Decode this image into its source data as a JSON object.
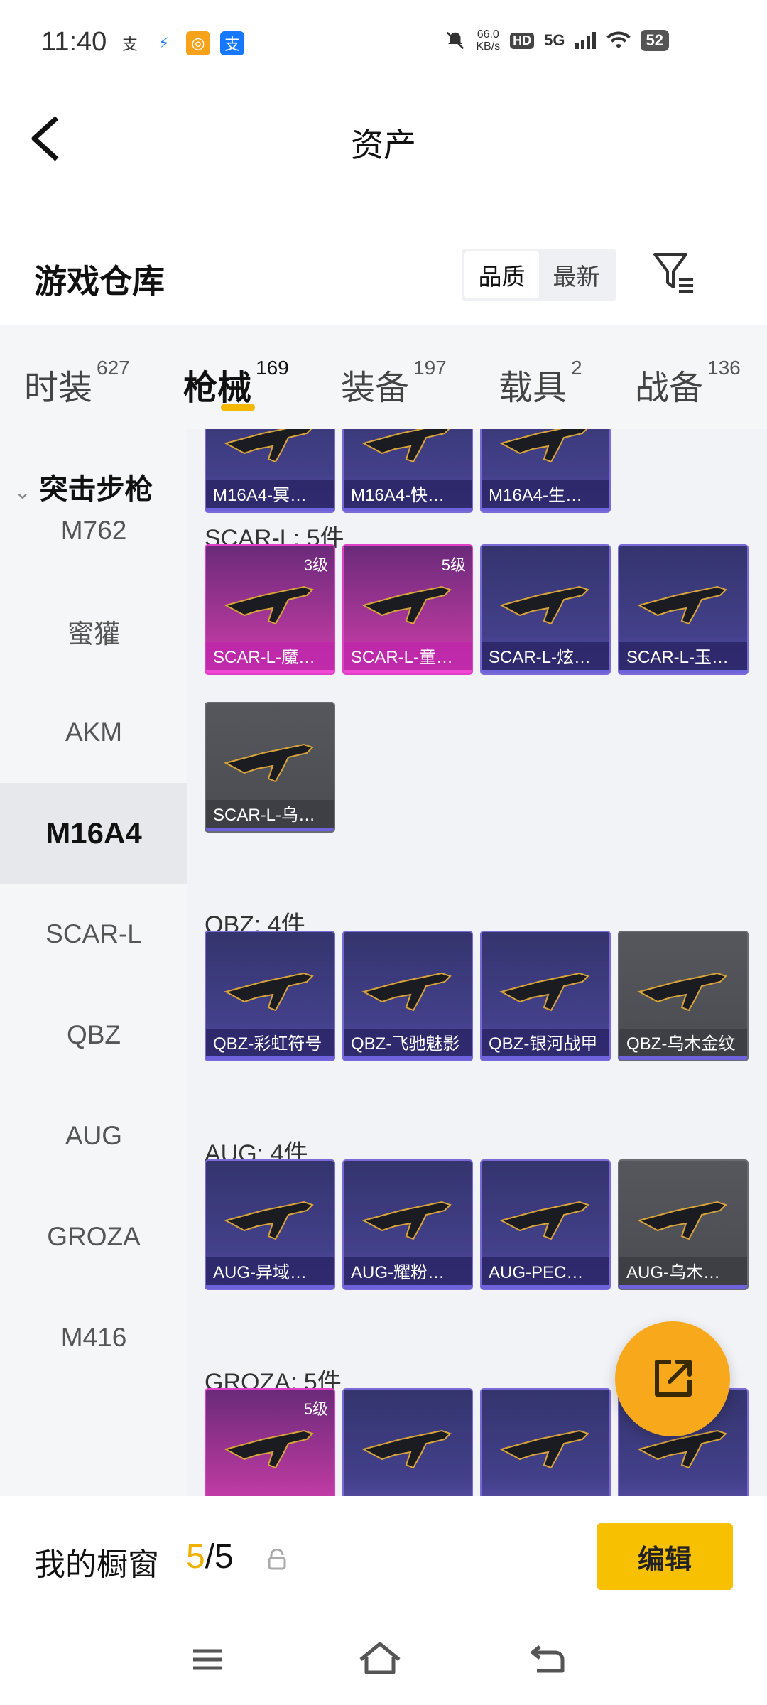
{
  "status_bar": {
    "time": "11:40",
    "apps": [
      {
        "icon": "alipay-outline-icon",
        "label": "支"
      },
      {
        "icon": "bank-app-icon",
        "label": "⚡"
      },
      {
        "icon": "orange-app-icon",
        "label": "◎"
      },
      {
        "icon": "alipay-icon",
        "label": "支"
      }
    ],
    "speed_value": "66.0",
    "speed_unit": "KB/s",
    "hd_label": "HD",
    "network": "5G",
    "battery": "52"
  },
  "header": {
    "title": "资产"
  },
  "warehouse": {
    "title": "游戏仓库",
    "sort_options": [
      "品质",
      "最新"
    ],
    "active_sort": 0
  },
  "tabs": [
    {
      "label": "时装",
      "count": "627"
    },
    {
      "label": "枪械",
      "count": "169"
    },
    {
      "label": "装备",
      "count": "197"
    },
    {
      "label": "载具",
      "count": "2"
    },
    {
      "label": "战备",
      "count": "136"
    }
  ],
  "sidebar": {
    "category": "突击步枪",
    "items": [
      "M762",
      "蜜獾",
      "AKM",
      "M16A4",
      "SCAR-L",
      "QBZ",
      "AUG",
      "GROZA",
      "M416"
    ],
    "selected": "M16A4"
  },
  "content": {
    "m16_partial": [
      {
        "name": "M16A4-冥…",
        "style": "purple"
      },
      {
        "name": "M16A4-快…",
        "style": "purple"
      },
      {
        "name": "M16A4-生…",
        "style": "purple"
      }
    ],
    "sections": [
      {
        "title": "SCAR-L: 5件",
        "items": [
          {
            "name": "SCAR-L-魔…",
            "style": "pink",
            "level": "3级"
          },
          {
            "name": "SCAR-L-童…",
            "style": "pink",
            "level": "5级"
          },
          {
            "name": "SCAR-L-炫…",
            "style": "purple",
            "level": ""
          },
          {
            "name": "SCAR-L-玉…",
            "style": "purple",
            "level": ""
          },
          {
            "name": "SCAR-L-乌…",
            "style": "gray",
            "level": ""
          }
        ]
      },
      {
        "title": "QBZ: 4件",
        "items": [
          {
            "name": "QBZ-彩虹符号",
            "style": "purple",
            "level": ""
          },
          {
            "name": "QBZ-飞驰魅影",
            "style": "purple",
            "level": ""
          },
          {
            "name": "QBZ-银河战甲",
            "style": "purple",
            "level": ""
          },
          {
            "name": "QBZ-乌木金纹",
            "style": "gray",
            "level": ""
          }
        ]
      },
      {
        "title": "AUG: 4件",
        "items": [
          {
            "name": "AUG-异域…",
            "style": "purple",
            "level": ""
          },
          {
            "name": "AUG-耀粉…",
            "style": "purple",
            "level": ""
          },
          {
            "name": "AUG-PEC…",
            "style": "purple",
            "level": ""
          },
          {
            "name": "AUG-乌木…",
            "style": "gray",
            "level": ""
          }
        ]
      },
      {
        "title": "GROZA: 5件",
        "items": [
          {
            "name": "",
            "style": "pink",
            "level": "5级"
          },
          {
            "name": "",
            "style": "purple",
            "level": ""
          },
          {
            "name": "",
            "style": "purple",
            "level": ""
          },
          {
            "name": "",
            "style": "purple",
            "level": ""
          }
        ]
      }
    ]
  },
  "bottom": {
    "label": "我的橱窗",
    "used": "5",
    "separator": "/",
    "total": "5",
    "edit_label": "编辑"
  },
  "colors": {
    "accent": "#f7c000",
    "fab": "#f7a91b"
  }
}
